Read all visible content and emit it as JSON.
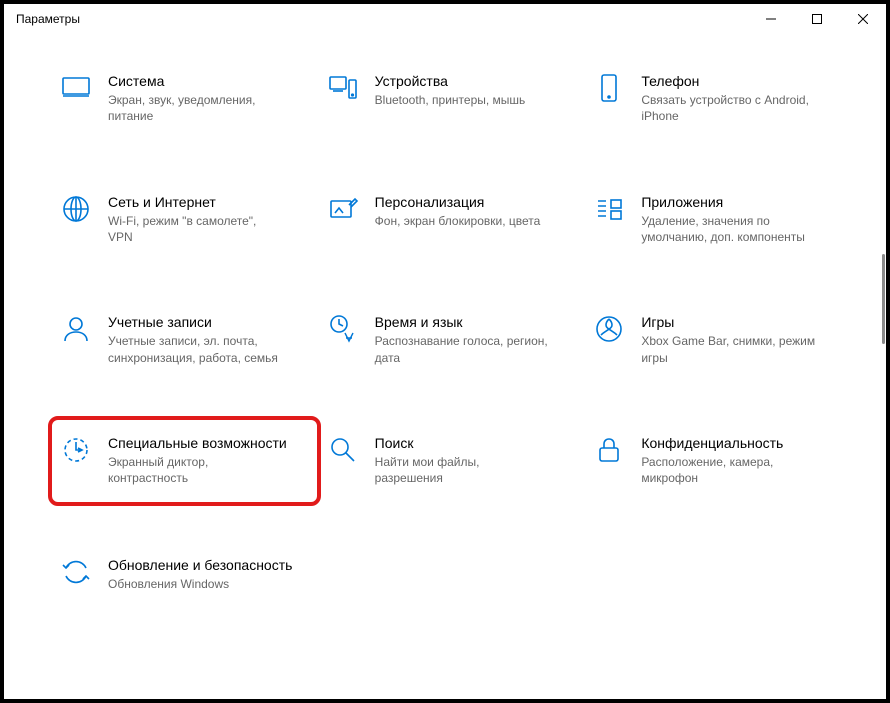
{
  "window": {
    "title": "Параметры"
  },
  "tiles": [
    {
      "title": "Система",
      "desc": "Экран, звук, уведомления, питание"
    },
    {
      "title": "Устройства",
      "desc": "Bluetooth, принтеры, мышь"
    },
    {
      "title": "Телефон",
      "desc": "Связать устройство с Android, iPhone"
    },
    {
      "title": "Сеть и Интернет",
      "desc": "Wi-Fi, режим \"в самолете\", VPN"
    },
    {
      "title": "Персонализация",
      "desc": "Фон, экран блокировки, цвета"
    },
    {
      "title": "Приложения",
      "desc": "Удаление, значения по умолчанию, доп. компоненты"
    },
    {
      "title": "Учетные записи",
      "desc": "Учетные записи, эл. почта, синхронизация, работа, семья"
    },
    {
      "title": "Время и язык",
      "desc": "Распознавание голоса, регион, дата"
    },
    {
      "title": "Игры",
      "desc": "Xbox Game Bar, снимки, режим игры"
    },
    {
      "title": "Специальные возможности",
      "desc": "Экранный диктор, контрастность"
    },
    {
      "title": "Поиск",
      "desc": "Найти мои файлы, разрешения"
    },
    {
      "title": "Конфиденциальность",
      "desc": "Расположение, камера, микрофон"
    },
    {
      "title": "Обновление и безопасность",
      "desc": "Обновления Windows"
    }
  ],
  "highlight_index": 9
}
